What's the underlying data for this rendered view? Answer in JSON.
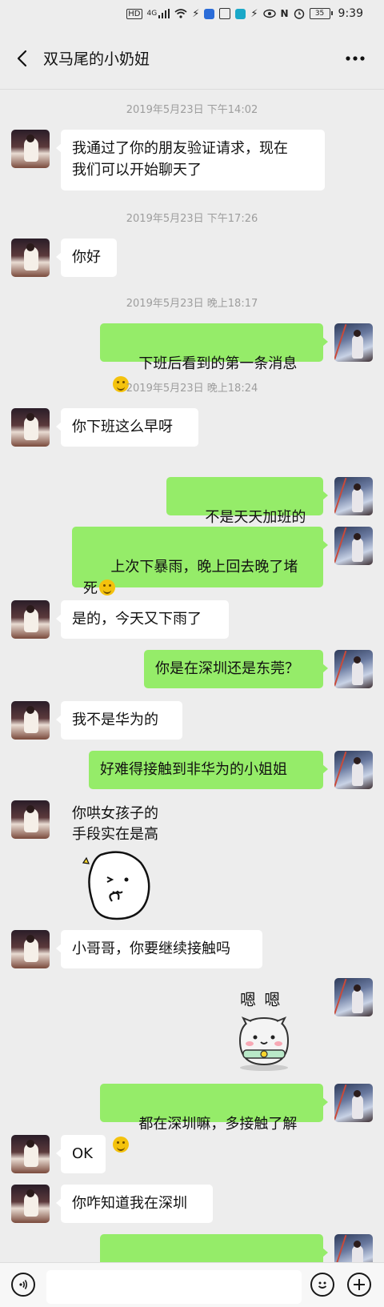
{
  "status_bar": {
    "network_label": "HD",
    "signal_label": "4G",
    "battery": "35",
    "time": "9:39"
  },
  "header": {
    "title": "双马尾的小奶妞"
  },
  "messages": [
    {
      "type": "time",
      "text": "2019年5月23日 下午14:02"
    },
    {
      "type": "msg",
      "side": "left",
      "text": "我通过了你的朋友验证请求，现在\n我们可以开始聊天了"
    },
    {
      "type": "time",
      "text": "2019年5月23日 下午17:26"
    },
    {
      "type": "msg",
      "side": "left",
      "text": "你好"
    },
    {
      "type": "time",
      "text": "2019年5月23日 晚上18:17"
    },
    {
      "type": "msg",
      "side": "right",
      "text": "下班后看到的第一条消息",
      "emoji": "thinking-emoji"
    },
    {
      "type": "time",
      "text": "2019年5月23日 晚上18:24"
    },
    {
      "type": "msg",
      "side": "left",
      "text": "你下班这么早呀"
    },
    {
      "type": "msg",
      "side": "right",
      "text": "不是天天加班的",
      "emoji": "smile-emoji"
    },
    {
      "type": "msg",
      "side": "right",
      "text": "上次下暴雨，晚上回去晚了堵死",
      "emoji": "cry-laugh-emoji"
    },
    {
      "type": "msg",
      "side": "left",
      "text": "是的，今天又下雨了"
    },
    {
      "type": "msg",
      "side": "right",
      "text": "你是在深圳还是东莞？"
    },
    {
      "type": "msg",
      "side": "left",
      "text": "我不是华为的"
    },
    {
      "type": "msg",
      "side": "right",
      "text": "好难得接触到非华为的小姐姐"
    },
    {
      "type": "sticker",
      "side": "left",
      "text": "你哄女孩子的\n手段实在是高",
      "sticker": "thinking-blob-sticker"
    },
    {
      "type": "msg",
      "side": "left",
      "text": "小哥哥，你要继续接触吗"
    },
    {
      "type": "sticker",
      "side": "right",
      "text": "嗯 嗯",
      "sticker": "hamster-nod-sticker"
    },
    {
      "type": "msg",
      "side": "right",
      "text": "都在深圳嘛，多接触了解",
      "emoji": "grin-emoji"
    },
    {
      "type": "msg",
      "side": "left",
      "text": "OK"
    },
    {
      "type": "msg",
      "side": "left",
      "text": "你咋知道我在深圳"
    }
  ],
  "input_bar": {
    "placeholder": ""
  },
  "icons": {
    "voice": "voice-icon",
    "emoji": "emoji-icon",
    "add": "add-icon",
    "back": "back-arrow-icon",
    "more": "more-dots-icon"
  },
  "colors": {
    "background": "#ededed",
    "bubble_right": "#95ec69",
    "bubble_left": "#ffffff",
    "timestamp": "#9d9d9d"
  }
}
